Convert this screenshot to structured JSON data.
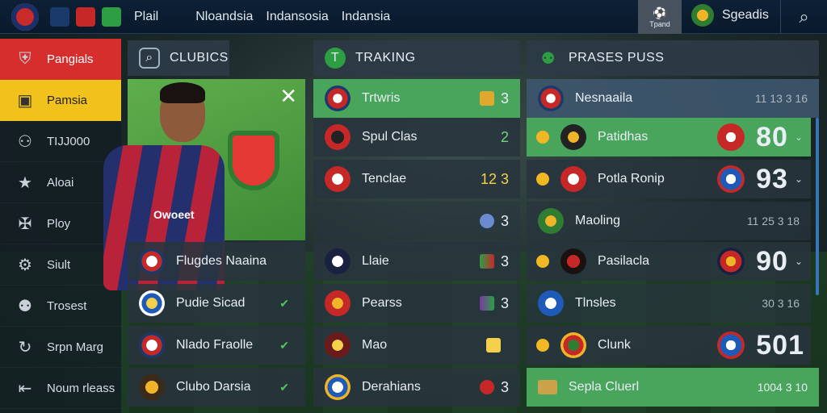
{
  "topbar": {
    "t1": "Plail",
    "t2": "Nloandsia",
    "t3": "Indansosia",
    "t4": "Indansia",
    "badge_label": "Tpand",
    "squads": "Sgeadis"
  },
  "sidebar": {
    "items": [
      {
        "label": "Pangials",
        "icon": "shield-icon",
        "style": "red"
      },
      {
        "label": "Pamsia",
        "icon": "chat-icon",
        "style": "yellow"
      },
      {
        "label": "TIJJ000",
        "icon": "person-icon",
        "style": ""
      },
      {
        "label": "Aloai",
        "icon": "star-icon",
        "style": ""
      },
      {
        "label": "Ploy",
        "icon": "player-icon",
        "style": ""
      },
      {
        "label": "Siult",
        "icon": "settings-icon",
        "style": ""
      },
      {
        "label": "Trosest",
        "icon": "team-icon",
        "style": ""
      },
      {
        "label": "Srpn Marg",
        "icon": "refresh-icon",
        "style": ""
      },
      {
        "label": "Noum rleass",
        "icon": "exit-icon",
        "style": ""
      }
    ]
  },
  "clubs": {
    "title": "CLUBICS",
    "sponsor": "Owoeet",
    "rows": [
      {
        "name": "Flugdes Naaina",
        "checked": false
      },
      {
        "name": "Pudie Sicad",
        "checked": true
      },
      {
        "name": "Nlado Fraolle",
        "checked": true
      },
      {
        "name": "Clubo Darsia",
        "checked": true
      }
    ]
  },
  "ranking": {
    "title": "TRAKING",
    "rows": [
      {
        "name": "Trtwris",
        "value": "3",
        "highlight": true
      },
      {
        "name": "Spul Clas",
        "value": "2",
        "highlight": false
      },
      {
        "name": "Tenclae",
        "value": "12 3",
        "highlight": false
      },
      {
        "name": "",
        "value": "3",
        "highlight": false
      },
      {
        "name": "Llaie",
        "value": "3",
        "highlight": false
      },
      {
        "name": "Pearss",
        "value": "3",
        "highlight": false
      },
      {
        "name": "Mao",
        "value": "",
        "highlight": false
      },
      {
        "name": "Derahians",
        "value": "3",
        "highlight": false
      }
    ]
  },
  "prases": {
    "title": "PRASES PUSS",
    "rows": [
      {
        "name": "Nesnaaila",
        "value": "11 13 3 16",
        "big": "",
        "highlight": false
      },
      {
        "name": "Patidhas",
        "value": "",
        "big": "80",
        "highlight": true
      },
      {
        "name": "Potla Ronip",
        "value": "",
        "big": "93",
        "highlight": false
      },
      {
        "name": "Maoling",
        "value": "11 25 3 18",
        "big": "",
        "highlight": false
      },
      {
        "name": "Pasilacla",
        "value": "",
        "big": "90",
        "highlight": false
      },
      {
        "name": "Tlnsles",
        "value": "30 3 16",
        "big": "",
        "highlight": false
      },
      {
        "name": "Clunk",
        "value": "",
        "big": "501",
        "highlight": false
      },
      {
        "name": "Sepla Cluerl",
        "value": "1004 3 10",
        "big": "",
        "highlight": true
      }
    ]
  },
  "colors": {
    "accent_green": "#49a55b",
    "accent_red": "#d62d2d",
    "accent_yellow": "#f0c21b"
  }
}
